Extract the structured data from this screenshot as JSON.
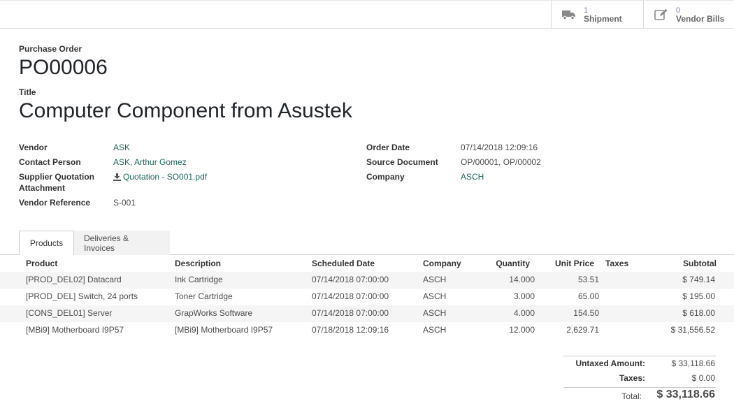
{
  "smart_buttons": {
    "shipment": {
      "count": "1",
      "label": "Shipment"
    },
    "vendor_bills": {
      "count": "0",
      "label": "Vendor Bills"
    }
  },
  "header": {
    "order_label": "Purchase Order",
    "order_number": "PO00006",
    "title_label": "Title",
    "title": "Computer Component from Asustek"
  },
  "fields_left": {
    "vendor_label": "Vendor",
    "vendor": "ASK",
    "contact_label": "Contact Person",
    "contact": "ASK, Arthur Gomez",
    "attachment_label_1": "Supplier Quotation",
    "attachment_label_2": "Attachment",
    "attachment": "Quotation - SO001.pdf",
    "vendor_ref_label": "Vendor Reference",
    "vendor_ref": "S-001"
  },
  "fields_right": {
    "order_date_label": "Order Date",
    "order_date": "07/14/2018 12:09:16",
    "source_label": "Source Document",
    "source": "OP/00001, OP/00002",
    "company_label": "Company",
    "company": "ASCH"
  },
  "tabs": [
    "Products",
    "Deliveries & Invoices"
  ],
  "table": {
    "columns": [
      "Product",
      "Description",
      "Scheduled Date",
      "Company",
      "Quantity",
      "Unit Price",
      "Taxes",
      "Subtotal"
    ],
    "rows": [
      [
        "[PROD_DEL02] Datacard",
        "Ink Cartridge",
        "07/14/2018 07:00:00",
        "ASCH",
        "14.000",
        "53.51",
        "",
        "$ 749.14"
      ],
      [
        "[PROD_DEL] Switch, 24 ports",
        "Toner Cartridge",
        "07/14/2018 07:00:00",
        "ASCH",
        "3.000",
        "65.00",
        "",
        "$ 195.00"
      ],
      [
        "[CONS_DEL01] Server",
        "GrapWorks Software",
        "07/14/2018 07:00:00",
        "ASCH",
        "4.000",
        "154.50",
        "",
        "$ 618.00"
      ],
      [
        "[MBi9] Motherboard I9P57",
        "[MBi9] Motherboard I9P57",
        "07/18/2018 12:09:16",
        "ASCH",
        "12.000",
        "2,629.71",
        "",
        "$ 31,556.52"
      ]
    ]
  },
  "totals": {
    "untaxed_label": "Untaxed Amount:",
    "untaxed": "$ 33,118.66",
    "taxes_label": "Taxes:",
    "taxes": "$ 0.00",
    "total_label": "Total:",
    "total": "$ 33,118.66"
  },
  "colors": {
    "link": "#21665e",
    "smart_count": "#7c7bad"
  }
}
